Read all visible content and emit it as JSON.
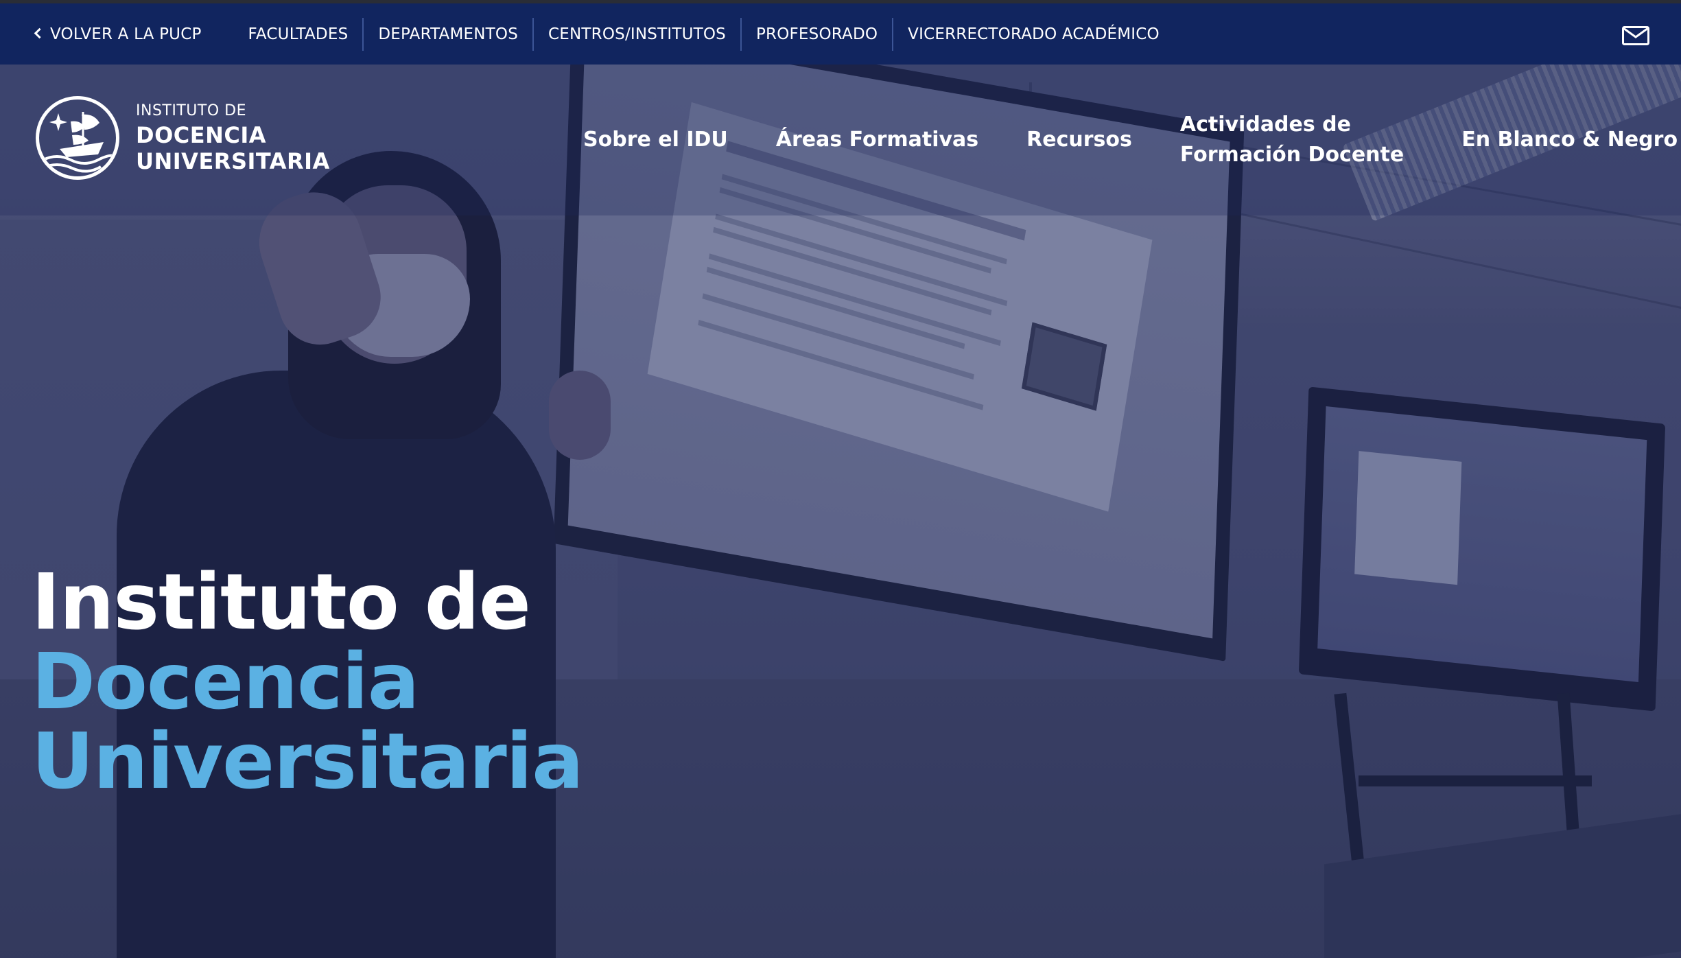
{
  "topbar": {
    "back_label": "VOLVER A LA PUCP",
    "links": [
      "FACULTADES",
      "DEPARTAMENTOS",
      "CENTROS/INSTITUTOS",
      "PROFESORADO",
      "VICERRECTORADO ACADÉMICO"
    ],
    "mail_icon": "mail-icon"
  },
  "logo": {
    "line1": "INSTITUTO DE",
    "line2": "DOCENCIA",
    "line3": "UNIVERSITARIA"
  },
  "mainnav": {
    "items": [
      "Sobre el IDU",
      "Áreas Formativas",
      "Recursos",
      "Actividades de",
      "Formación Docente",
      "En Blanco & Negro"
    ]
  },
  "hero": {
    "title_line1": "Instituto de",
    "title_line2": "Docencia",
    "title_line3": "Universitaria"
  },
  "colors": {
    "topbar_bg": "#11255f",
    "accent_blue": "#5bb1e3",
    "text": "#ffffff"
  }
}
